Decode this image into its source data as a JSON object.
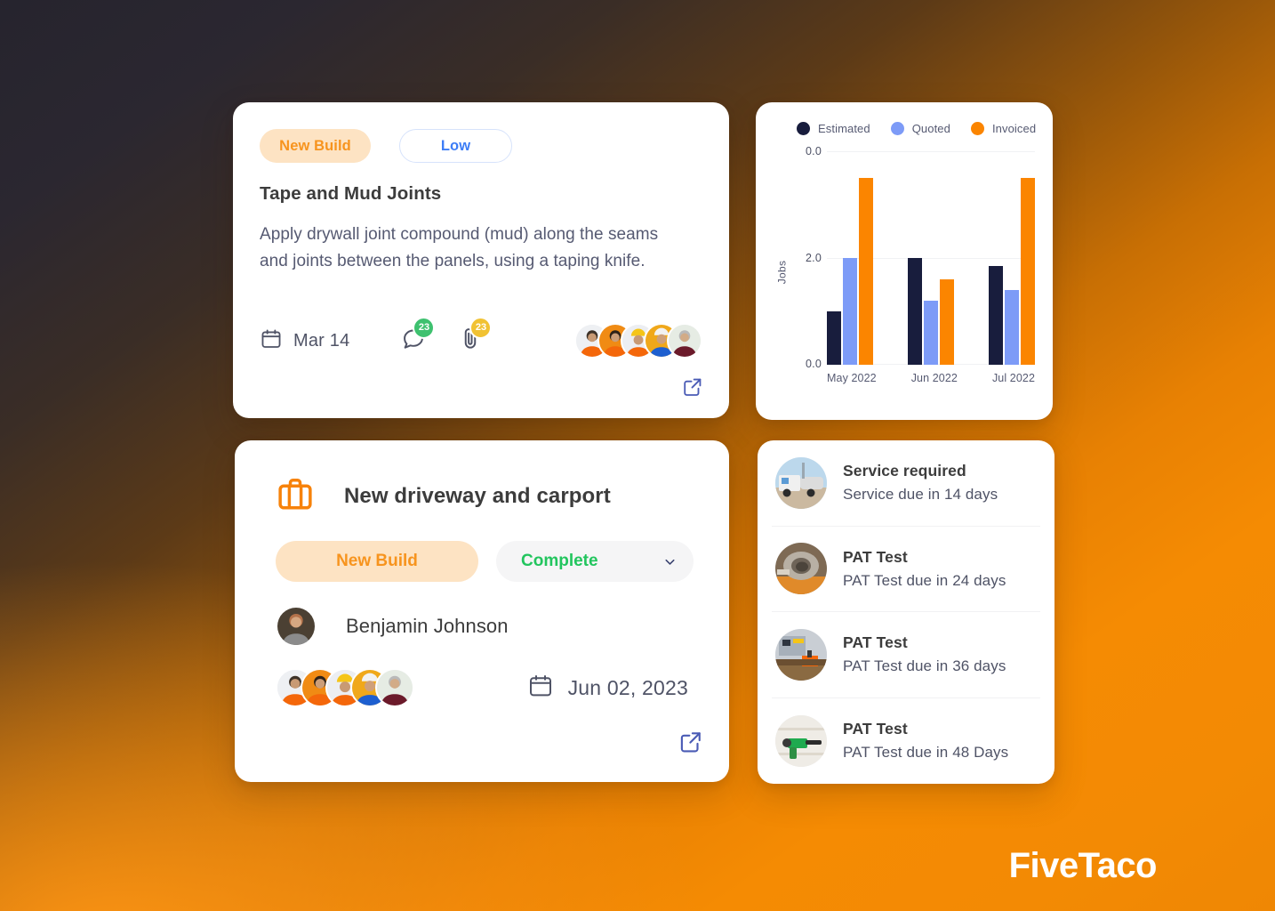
{
  "brand": {
    "logo_text": "FiveTaco",
    "accent_orange": "#f7941e",
    "accent_navy": "#181d3d"
  },
  "task_card": {
    "category_chip": "New Build",
    "priority_chip": "Low",
    "title": "Tape and Mud Joints",
    "description": "Apply drywall joint compound (mud) along the seams and joints between the panels, using a taping knife.",
    "date": "Mar 14",
    "comment_count": "23",
    "attachment_count": "23",
    "comment_badge_color": "#3ec16f",
    "attachment_badge_color": "#f1c233",
    "assignees": [
      "worker-1",
      "worker-2",
      "worker-3",
      "worker-4",
      "worker-5"
    ]
  },
  "chart_card": {
    "chart_data": {
      "type": "bar",
      "title": "",
      "xlabel": "",
      "ylabel": "Jobs",
      "categories": [
        "May 2022",
        "Jun 2022",
        "Jul 2022"
      ],
      "ytick_labels": [
        "0.0",
        "2.0",
        "0.0"
      ],
      "ylim": [
        0,
        4
      ],
      "grid": true,
      "legend_position": "top-left",
      "series": [
        {
          "name": "Estimated",
          "color": "#181d3d",
          "values": [
            1.0,
            2.0,
            1.85
          ]
        },
        {
          "name": "Quoted",
          "color": "#7d9bf7",
          "values": [
            2.0,
            1.2,
            1.4
          ]
        },
        {
          "name": "Invoiced",
          "color": "#fb8500",
          "values": [
            3.5,
            1.6,
            3.5
          ]
        }
      ]
    }
  },
  "job_card": {
    "title": "New driveway and carport",
    "category_chip": "New Build",
    "status_label": "Complete",
    "status_color": "#22c55e",
    "owner_name": "Benjamin Johnson",
    "date": "Jun  02, 2023",
    "team": [
      "worker-1",
      "worker-2",
      "worker-3",
      "worker-4",
      "worker-5"
    ]
  },
  "list_card": {
    "items": [
      {
        "title": "Service required",
        "subtitle": "Service due in 14 days",
        "thumb": "truck-thumb"
      },
      {
        "title": "PAT Test",
        "subtitle": "PAT Test due in 24 days",
        "thumb": "mixer-thumb"
      },
      {
        "title": "PAT Test",
        "subtitle": "PAT Test due in 36 days",
        "thumb": "tools-thumb"
      },
      {
        "title": "PAT Test",
        "subtitle": "PAT Test due in 48 Days",
        "thumb": "drill-thumb"
      }
    ]
  }
}
